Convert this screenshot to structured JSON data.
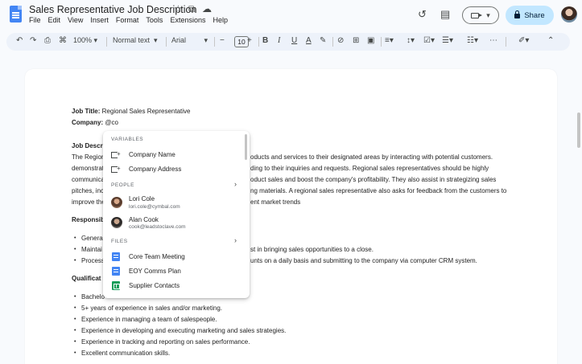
{
  "app": {
    "doc_title": "Sales Representative Job Description",
    "menu": [
      "File",
      "Edit",
      "View",
      "Insert",
      "Format",
      "Tools",
      "Extensions",
      "Help"
    ],
    "share_label": "Share"
  },
  "toolbar": {
    "zoom": "100%",
    "style": "Normal text",
    "font": "Arial",
    "font_size": "10"
  },
  "document": {
    "job_title_label": "Job Title:",
    "job_title_value": "Regional Sales Representative",
    "company_label": "Company:",
    "company_value": "@co",
    "desc_heading_part": "Job Descri",
    "desc_lines": [
      "The Region",
      "demonstrati",
      "communica",
      "pitches, inc",
      "improve the"
    ],
    "desc_lines_right": [
      "oducts and services to their designated areas by interacting with potential customers.",
      "ding to their inquiries and requests. Regional sales representatives should be highly",
      "oduct sales and boost the company's profitability. They also assist in strategizing sales",
      "ng materials. A regional sales representative also asks for feedback from the customers to",
      "ent market trends"
    ],
    "resp_heading_part": "Responsib",
    "resp_left": [
      "General",
      "Maintai",
      "Process"
    ],
    "resp_right": [
      "",
      "st in bringing sales opportunities to a close.",
      "unts on a daily basis and submitting to the company via computer CRM system."
    ],
    "qual_heading_part": "Qualificat",
    "qual_items": [
      "Bachelo",
      "5+ years of experience in sales and/or marketing.",
      "Experience in managing a team of salespeople.",
      "Experience in developing and executing marketing and sales strategies.",
      "Experience in tracking and reporting on sales performance.",
      "Excellent communication skills."
    ]
  },
  "dropdown": {
    "variables_header": "VARIABLES",
    "variables": [
      "Company Name",
      "Company Address"
    ],
    "people_header": "PEOPLE",
    "people": [
      {
        "name": "Lori Cole",
        "email": "lori.cole@cymbal.com"
      },
      {
        "name": "Alan Cook",
        "email": "cook@leadstoclave.com"
      }
    ],
    "files_header": "FILES",
    "files": [
      {
        "name": "Core Team Meeting",
        "kind": "doc"
      },
      {
        "name": "EOY Comms Plan",
        "kind": "doc"
      },
      {
        "name": "Supplier Contacts",
        "kind": "sheet"
      }
    ]
  },
  "colors": {
    "share_bg": "#c2e7ff",
    "toolbar_bg": "#edf2fa",
    "docs_blue": "#4285f4",
    "sheets_green": "#0f9d58"
  }
}
